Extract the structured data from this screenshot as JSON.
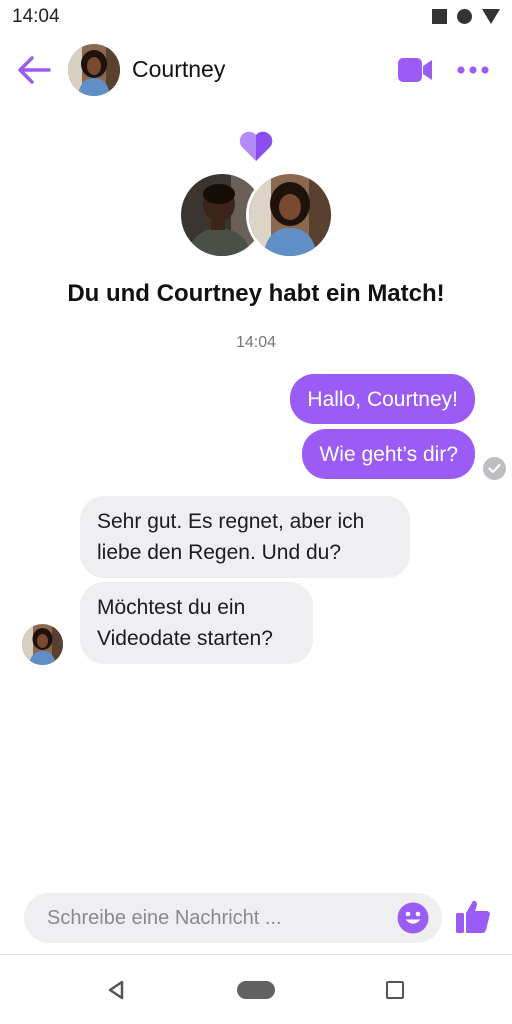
{
  "status_bar": {
    "time": "14:04",
    "icons": [
      "square-icon",
      "circle-icon",
      "triangle-icon"
    ]
  },
  "header": {
    "contact_name": "Courtney",
    "back_icon": "arrow-left-icon",
    "video_icon": "video-camera-icon",
    "more_icon": "more-dots-icon"
  },
  "match": {
    "icon": "heart-icon",
    "title": "Du und Courtney habt ein Match!"
  },
  "chat": {
    "timestamp": "14:04",
    "messages": [
      {
        "direction": "outgoing",
        "text": "Hallo, Courtney!"
      },
      {
        "direction": "outgoing",
        "text": "Wie geht’s dir?"
      },
      {
        "direction": "incoming",
        "text": "Sehr gut. Es regnet, aber ich liebe den Regen. Und du?"
      },
      {
        "direction": "incoming",
        "text": "Möchtest du ein Videodate starten?"
      }
    ],
    "read_icon": "check-circle-icon"
  },
  "composer": {
    "placeholder": "Schreibe eine Nachricht ...",
    "value": "",
    "emoji_icon": "smiley-icon",
    "like_icon": "thumbs-up-icon"
  },
  "colors": {
    "accent": "#9b5cf5",
    "incoming_bubble": "#efeff1"
  }
}
